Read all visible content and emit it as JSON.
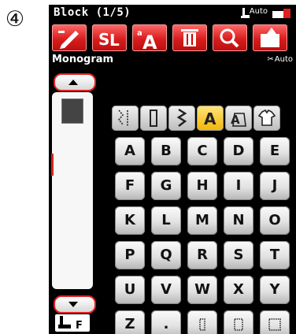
{
  "step_marker": "④",
  "header": {
    "title": "Block (1/5)",
    "auto_label": "Auto"
  },
  "toolbar": {
    "icons": [
      "edit-icon",
      "mirror-icon",
      "size-icon",
      "delete-icon",
      "zoom-icon",
      "memory-icon"
    ]
  },
  "section": {
    "label": "Monogram",
    "auto_label": "Auto"
  },
  "categories": [
    "stitch-pattern-icon",
    "satin-icon",
    "decorative-icon",
    "alphabet-icon",
    "quilt-icon",
    "shirt-icon"
  ],
  "selected_category": 3,
  "keys": [
    [
      "A",
      "B",
      "C",
      "D",
      "E"
    ],
    [
      "F",
      "G",
      "H",
      "I",
      "J"
    ],
    [
      "K",
      "L",
      "M",
      "N",
      "O"
    ],
    [
      "P",
      "Q",
      "R",
      "S",
      "T"
    ],
    [
      "U",
      "V",
      "W",
      "X",
      "Y"
    ],
    [
      "Z",
      ".",
      "",
      "",
      ""
    ]
  ],
  "side_footer": "F",
  "colors": {
    "accent": "#e02020",
    "selected": "#f2b600",
    "screen_bg": "#000000"
  }
}
